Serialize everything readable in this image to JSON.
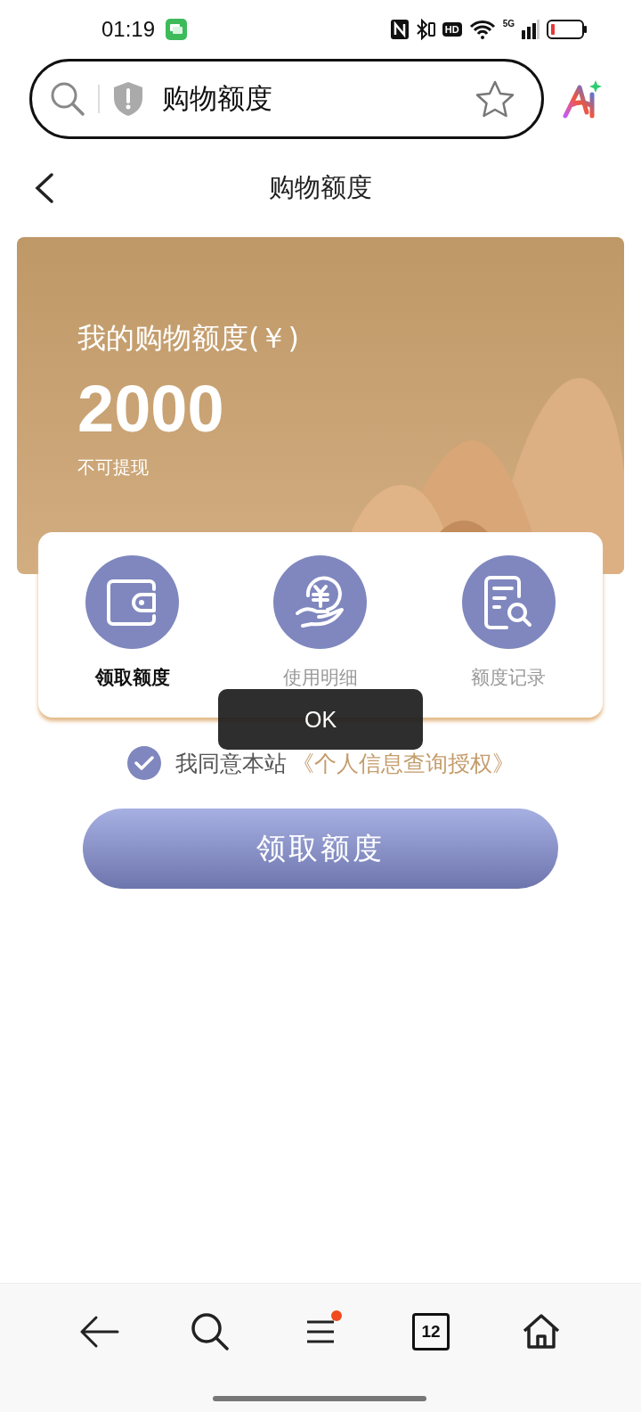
{
  "status_bar": {
    "time": "01:19",
    "hd": "HD",
    "network": "5G"
  },
  "address_bar": {
    "value": "购物额度",
    "bookmarked": false
  },
  "header": {
    "title": "购物额度"
  },
  "quota_card": {
    "label": "我的购物额度(￥)",
    "amount": "2000",
    "note": "不可提现"
  },
  "actions": [
    {
      "kind": "wallet",
      "label": "领取额度",
      "selected": true
    },
    {
      "kind": "usage",
      "label": "使用明细",
      "selected": false
    },
    {
      "kind": "record",
      "label": "额度记录",
      "selected": false
    }
  ],
  "toast": "OK",
  "agreement": {
    "checked": true,
    "text": "我同意本站",
    "link": "《个人信息查询授权》"
  },
  "claim_button": "领取额度",
  "bottom_nav": {
    "tab_count": "12",
    "menu_badge": true
  }
}
